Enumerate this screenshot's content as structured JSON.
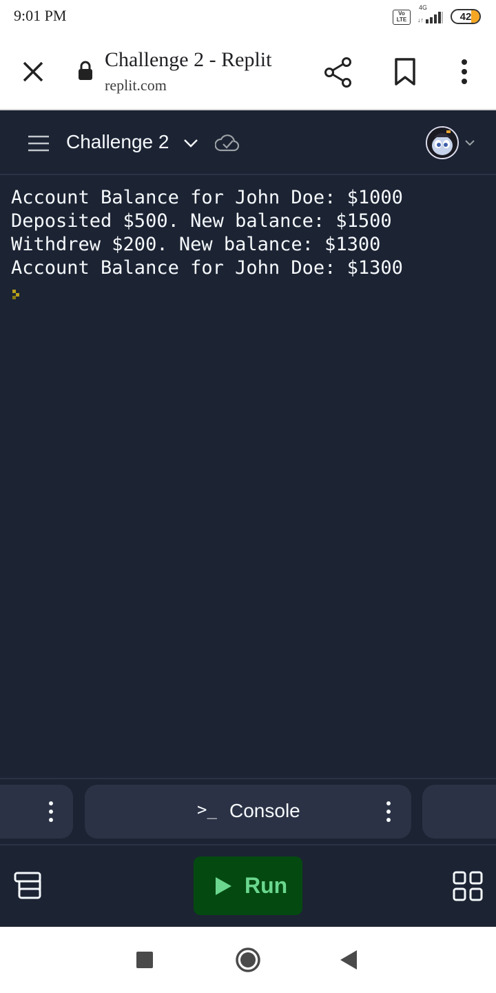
{
  "status_bar": {
    "time": "9:01 PM",
    "network_badge": "Vo LTE",
    "network_type": "4G",
    "battery_level": "42"
  },
  "browser": {
    "page_title": "Challenge 2 - Replit",
    "url": "replit.com"
  },
  "header": {
    "repl_name": "Challenge 2"
  },
  "console": {
    "lines": [
      "Account Balance for John Doe: $1000",
      "Deposited $500. New balance: $1500",
      "Withdrew $200. New balance: $1300",
      "Account Balance for John Doe: $1300"
    ]
  },
  "tabs": {
    "console_prompt": ">_",
    "console_label": "Console"
  },
  "action_bar": {
    "run_label": "Run"
  },
  "colors": {
    "background": "#1c2333",
    "surface": "#2b3245",
    "run_button_bg": "#044a10",
    "run_button_fg": "#6bd78f",
    "text": "#f5f9fc",
    "battery": "#f5a623"
  },
  "icons": [
    "close-icon",
    "lock-icon",
    "share-icon",
    "bookmark-icon",
    "more-vert-icon",
    "hamburger-icon",
    "chevron-down-icon",
    "saved-check-icon",
    "avatar",
    "more-vert-icon",
    "play-icon",
    "layers-icon",
    "grid-icon",
    "square-icon",
    "circle-icon",
    "triangle-back-icon"
  ]
}
